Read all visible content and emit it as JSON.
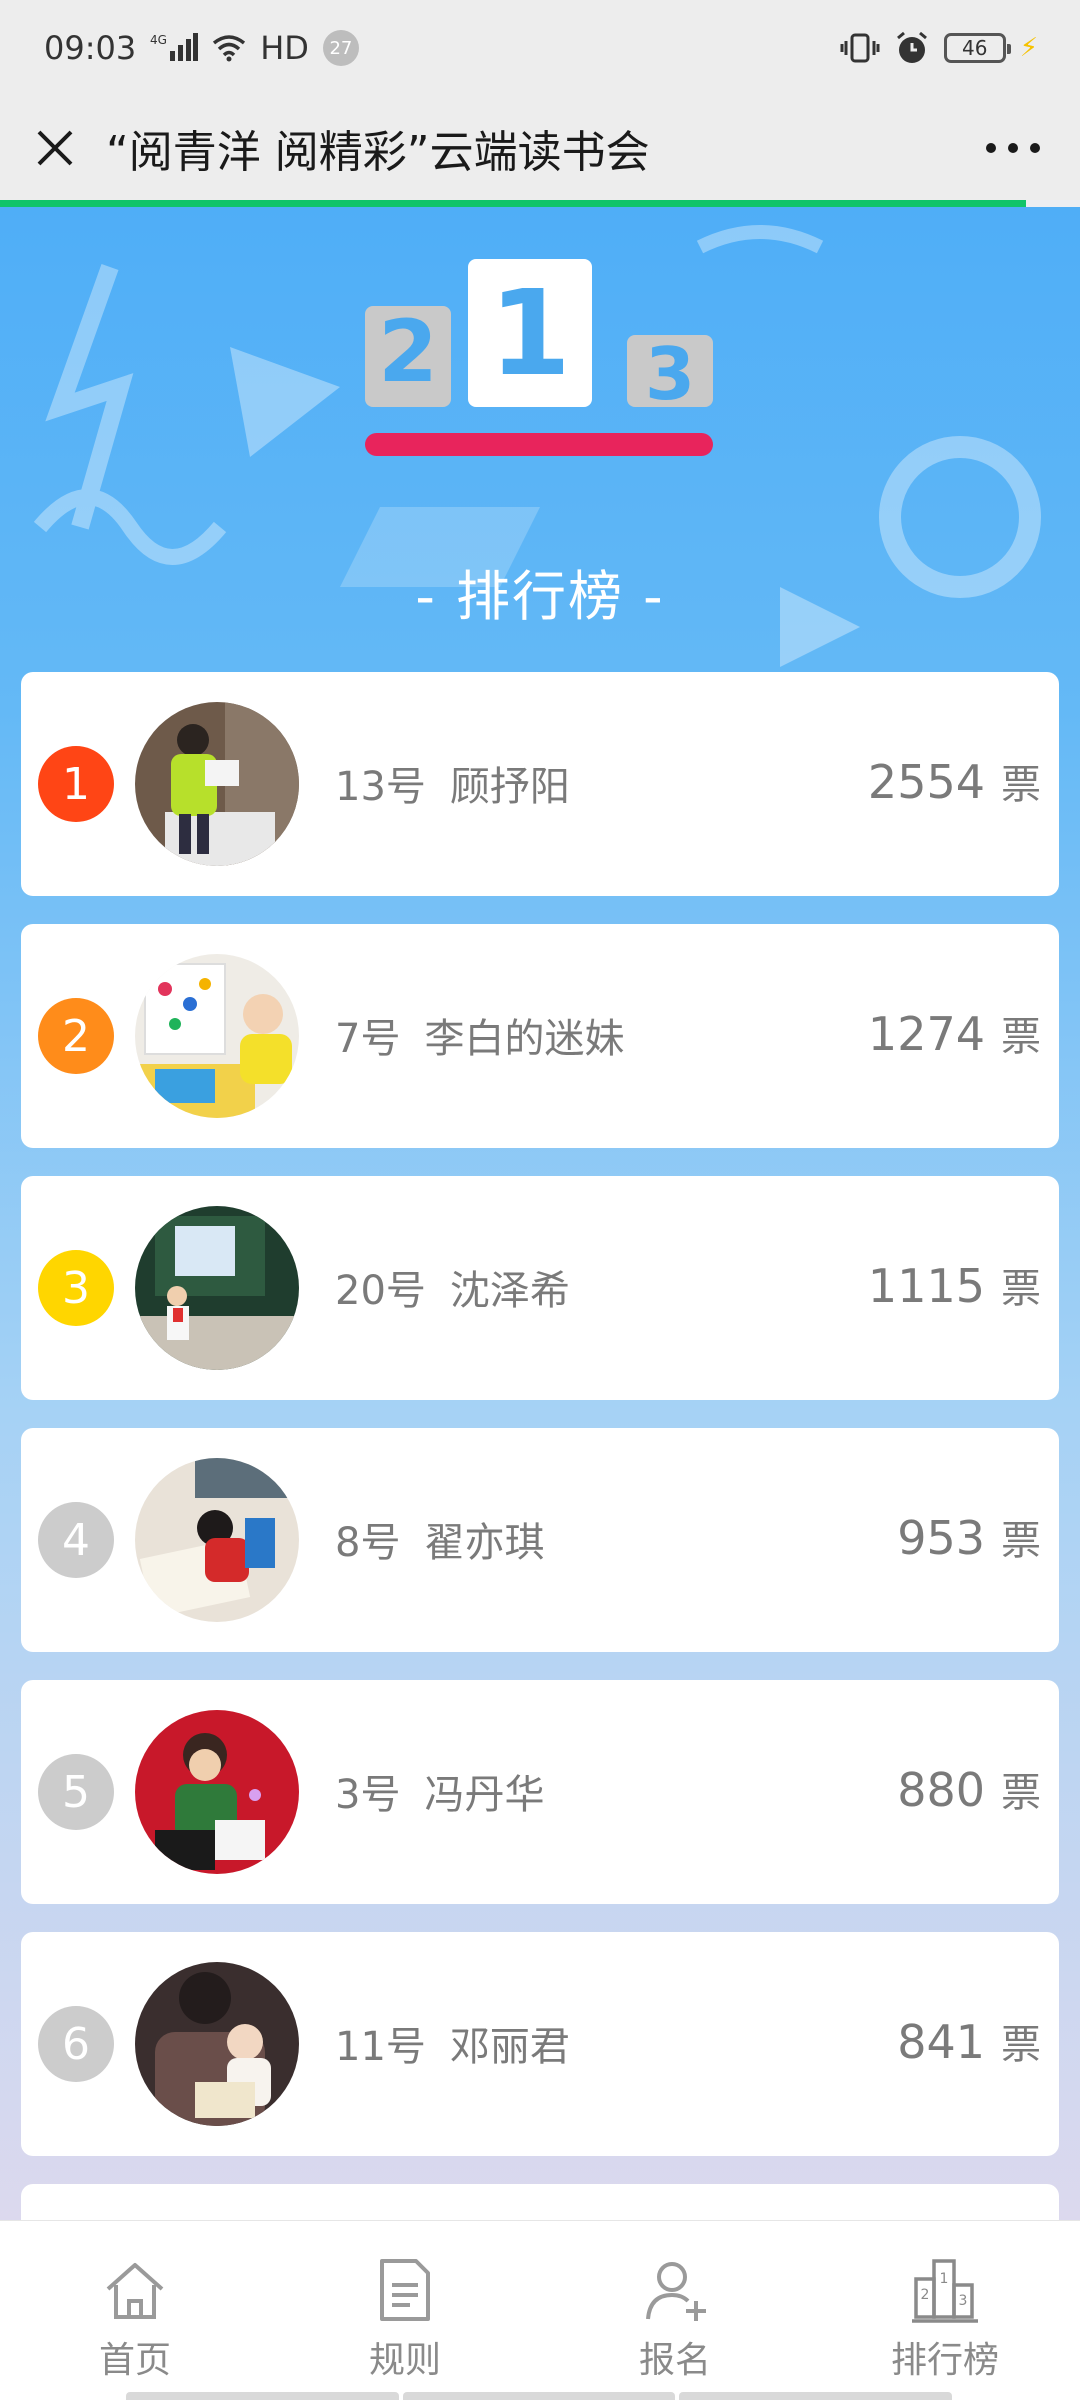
{
  "status_bar": {
    "time": "09:03",
    "network": "4G",
    "hd": "HD",
    "notification_count": "27",
    "battery": "46"
  },
  "title_bar": {
    "title": "“阅青洋 阅精彩”云端读书会",
    "close_icon": "close-icon",
    "more_icon": "more-icon",
    "progress": 0.95
  },
  "podium": {
    "first": "1",
    "second": "2",
    "third": "3"
  },
  "ranking_title": "- 排行榜 -",
  "colors": {
    "rank1": "#ff4515",
    "rank2": "#ff8c1a",
    "rank3": "#ffd600",
    "rank_other": "#cccccc",
    "accent_bar": "#e8245c",
    "progress": "#10c46a"
  },
  "entries": [
    {
      "rank": "1",
      "number": "13号",
      "name": "顾抒阳",
      "votes": "2554",
      "unit": "票"
    },
    {
      "rank": "2",
      "number": "7号",
      "name": "李白的迷妹",
      "votes": "1274",
      "unit": "票"
    },
    {
      "rank": "3",
      "number": "20号",
      "name": "沈泽希",
      "votes": "1115",
      "unit": "票"
    },
    {
      "rank": "4",
      "number": "8号",
      "name": "翟亦琪",
      "votes": "953",
      "unit": "票"
    },
    {
      "rank": "5",
      "number": "3号",
      "name": "冯丹华",
      "votes": "880",
      "unit": "票"
    },
    {
      "rank": "6",
      "number": "11号",
      "name": "邓丽君",
      "votes": "841",
      "unit": "票"
    }
  ],
  "nav": [
    {
      "label": "首页",
      "icon": "home-icon"
    },
    {
      "label": "规则",
      "icon": "document-icon"
    },
    {
      "label": "报名",
      "icon": "add-user-icon"
    },
    {
      "label": "排行榜",
      "icon": "podium-icon"
    }
  ]
}
